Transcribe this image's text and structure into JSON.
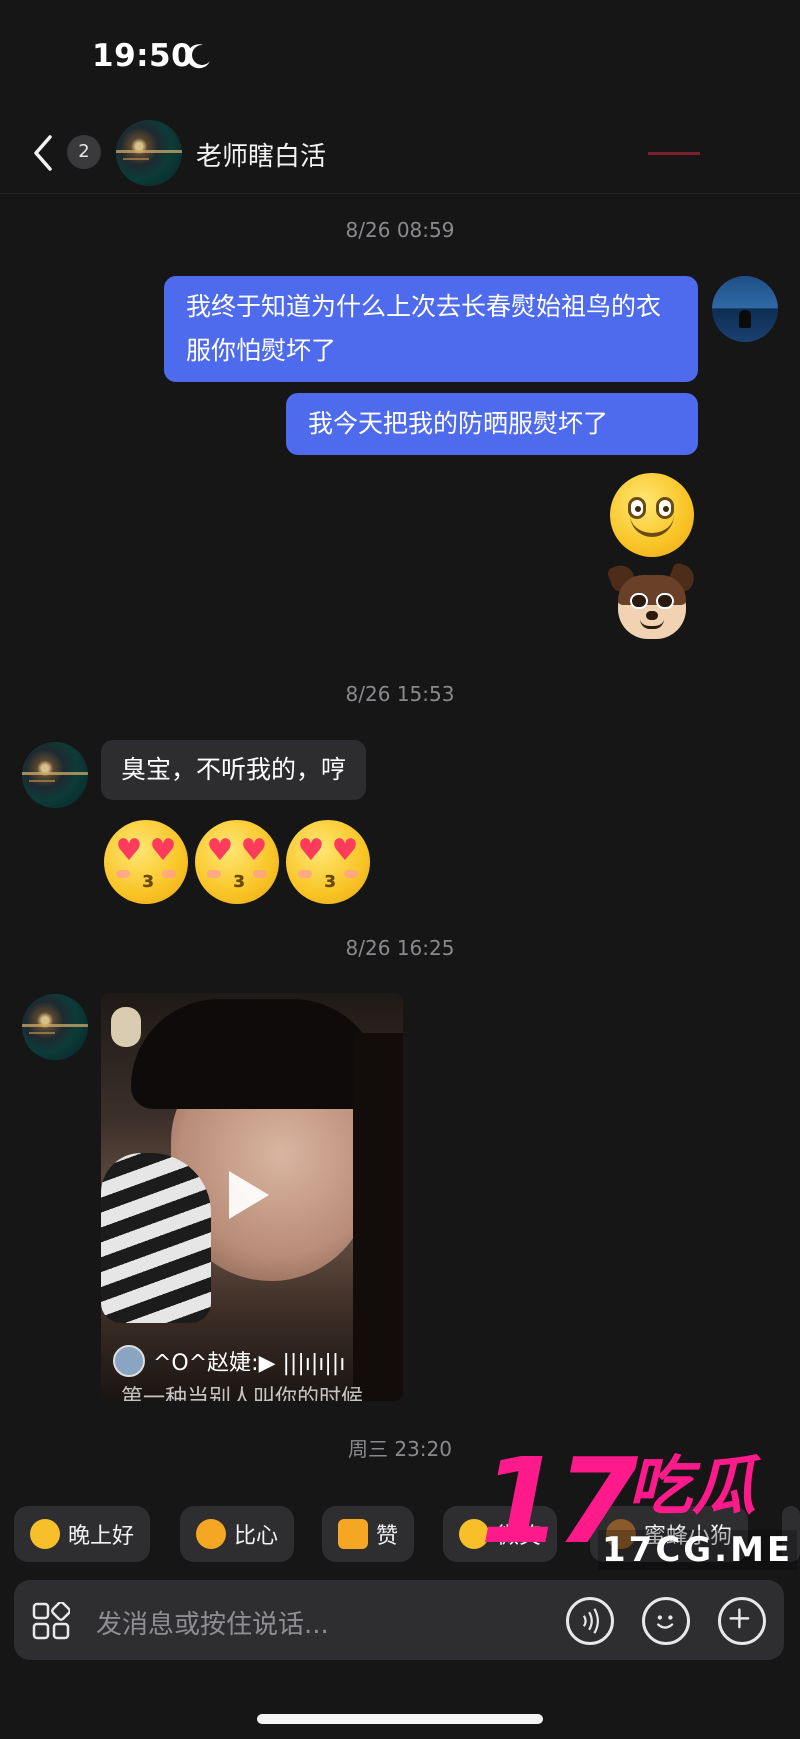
{
  "status_bar": {
    "time": "19:50",
    "moon_icon": "moon-icon"
  },
  "header": {
    "unread_count": "2",
    "contact_name": "老师瞎白活"
  },
  "messages": {
    "ts1": "8/26 08:59",
    "me1": "我终于知道为什么上次去长春熨始祖鸟的衣服你怕熨坏了",
    "me2": "我今天把我的防晒服熨坏了",
    "ts2": "8/26 15:53",
    "them1": "臭宝，不听我的，哼",
    "ts3": "8/26 16:25",
    "video": {
      "caption": "^O^赵婕:▶ |||ı|ı||ı",
      "subtitle": "第一种当别人叫你的时候"
    },
    "ts4": "周三 23:20"
  },
  "quick_replies": [
    {
      "label": "晚上好",
      "icon": "star-face-icon",
      "color": "#f7c02a"
    },
    {
      "label": "比心",
      "icon": "finger-heart-icon",
      "color": "#f5a623"
    },
    {
      "label": "赞",
      "icon": "thumbs-up-icon",
      "color": "#f5a623"
    },
    {
      "label": "微笑",
      "icon": "smile-icon",
      "color": "#f7c02a"
    },
    {
      "label": "蜜蜂小狗",
      "icon": "bee-dog-icon",
      "color": "#8b5a2b"
    }
  ],
  "watermark": {
    "number": "17",
    "text": "吃瓜",
    "url": "17CG.ME"
  },
  "input": {
    "placeholder": "发消息或按住说话..."
  },
  "colors": {
    "accent": "#4f6bed",
    "watermark": "#ff1a8c",
    "background": "#161616"
  }
}
